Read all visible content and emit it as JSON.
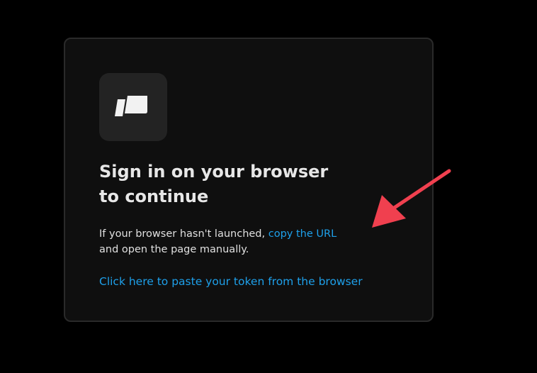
{
  "signin": {
    "title_line1": "Sign in on your browser",
    "title_line2": "to continue",
    "body_prefix": "If your browser hasn't launched, ",
    "copy_url_link": "copy the URL",
    "body_suffix": "and open the page manually.",
    "paste_token_link": "Click here to paste your token from the browser"
  },
  "icons": {
    "logo": "app-logo-icon",
    "annotation": "red-arrow-annotation"
  },
  "colors": {
    "background": "#000000",
    "card": "#0f0f0f",
    "card_border": "#2a2a2a",
    "logo_tile": "#232323",
    "title_text": "#e7e7e7",
    "link": "#1ea0ea",
    "arrow": "#f0404f"
  }
}
